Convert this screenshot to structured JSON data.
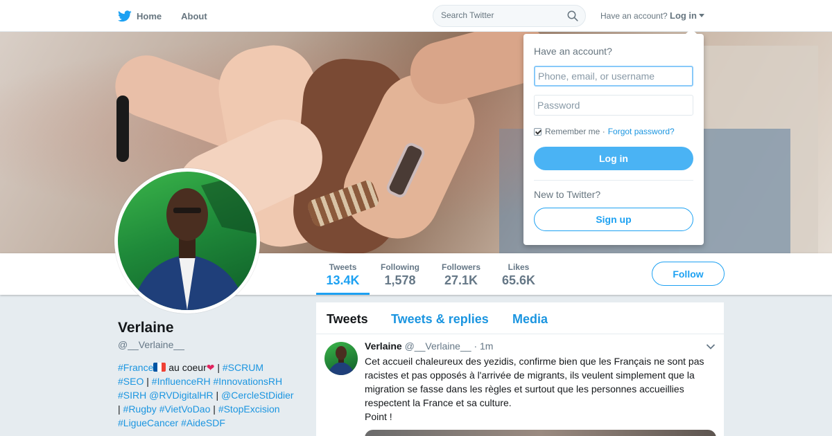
{
  "nav": {
    "home_label": "Home",
    "about_label": "About",
    "search_placeholder": "Search Twitter",
    "have_account": "Have an account?",
    "login_label": "Log in"
  },
  "profile": {
    "name": "Verlaine",
    "handle": "@__Verlaine__",
    "bio": {
      "t1": "#France",
      "t2": " au coeur",
      "t3": " | ",
      "t4": "#SCRUM",
      "t5": "#SEO",
      "t6": " | ",
      "t7": "#InfluenceRH",
      "t8": " ",
      "t9": "#InnovationsRH",
      "t10": "#SIRH",
      "t11": " ",
      "t12": "@RVDigitalHR",
      "t13": " | ",
      "t14": "@CercleStDidier",
      "t15": "| ",
      "t16": "#Rugby",
      "t17": " ",
      "t18": "#VietVoDao",
      "t19": " | ",
      "t20": "#StopExcision",
      "t21": "#LigueCancer",
      "t22": " ",
      "t23": "#AideSDF"
    },
    "follow_label": "Follow"
  },
  "stats": [
    {
      "label": "Tweets",
      "value": "13.4K"
    },
    {
      "label": "Following",
      "value": "1,578"
    },
    {
      "label": "Followers",
      "value": "27.1K"
    },
    {
      "label": "Likes",
      "value": "65.6K"
    }
  ],
  "timeline": {
    "tabs": [
      "Tweets",
      "Tweets & replies",
      "Media"
    ],
    "tweet": {
      "name": "Verlaine",
      "handle": "@__Verlaine__",
      "time": "· 1m",
      "text": "Cet accueil chaleureux des yezidis, confirme bien que les Français ne sont pas\nracistes et pas opposés à l'arrivée de migrants, ils veulent simplement que la\nmigration se fasse dans les règles et surtout que les personnes accueillies\nrespectent la France et sa culture.\nPoint !"
    }
  },
  "login_dropdown": {
    "title": "Have an account?",
    "username_placeholder": "Phone, email, or username",
    "password_placeholder": "Password",
    "remember_label": "Remember me ·",
    "forgot_label": "Forgot password?",
    "login_button": "Log in",
    "new_label": "New to Twitter?",
    "signup_button": "Sign up"
  },
  "colors": {
    "accent": "#1da1f2",
    "link": "#1b95e0",
    "heart": "#e0245e"
  },
  "icons": [
    "twitter-bird-icon",
    "search-icon",
    "caret-down-icon",
    "chevron-down-icon",
    "heart-icon",
    "france-flag-icon"
  ]
}
